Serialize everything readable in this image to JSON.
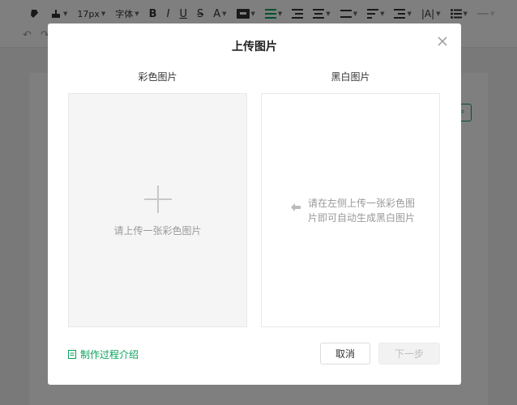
{
  "toolbar": {
    "font_size": "17px",
    "font_family": "字体",
    "bold": "B",
    "italic": "I",
    "underline": "U",
    "strike": "S",
    "font_color": "A"
  },
  "modal": {
    "title": "上传图片",
    "color_column_label": "彩色图片",
    "bw_column_label": "黑白图片",
    "upload_hint": "请上传一张彩色图片",
    "result_hint": "请在左侧上传一张彩色图片即可自动生成黑白图片",
    "intro_link": "制作过程介绍",
    "cancel_label": "取消",
    "next_label": "下一步"
  },
  "colors": {
    "accent": "#07a35a",
    "overlay": "rgba(0,0,0,0.5)"
  }
}
